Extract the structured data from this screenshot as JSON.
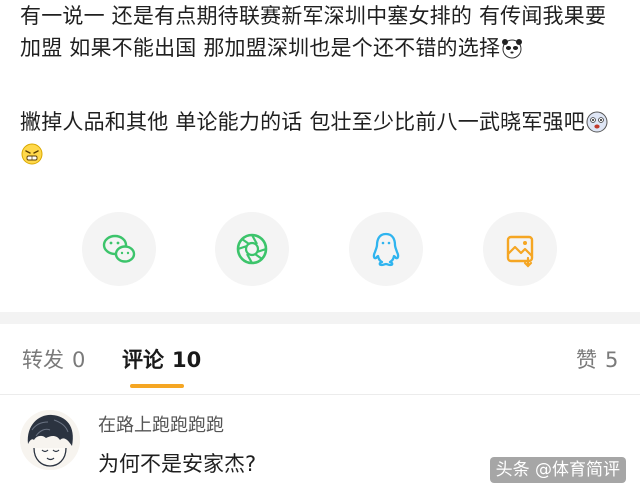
{
  "post": {
    "paragraph1": "有一说一 还是有点期待联赛新军深圳中塞女排的 有传闻我果要加盟 如果不能出国 那加盟深圳也是个还不错的选择",
    "paragraph2": "撇掉人品和其他 单论能力的话 包壮至少比前八一武晓军强吧",
    "emoji_1": "panda-emoji",
    "emoji_2": "shocked-face-emoji",
    "emoji_3": "grin-face-emoji"
  },
  "share": {
    "items": [
      {
        "icon": "wechat-icon",
        "color": "#3cc46b"
      },
      {
        "icon": "moments-icon",
        "color": "#3cc46b"
      },
      {
        "icon": "qq-icon",
        "color": "#2fb4ef"
      },
      {
        "icon": "save-image-icon",
        "color": "#f5a623"
      }
    ]
  },
  "tabs": {
    "repost_label": "转发",
    "repost_count": "0",
    "comment_label": "评论",
    "comment_count": "10",
    "like_label": "赞",
    "like_count": "5",
    "accent": "#f5a623"
  },
  "comment": {
    "user": "在路上跑跑跑跑",
    "text": "为何不是安家杰?"
  },
  "watermark": "头条 @体育简评"
}
